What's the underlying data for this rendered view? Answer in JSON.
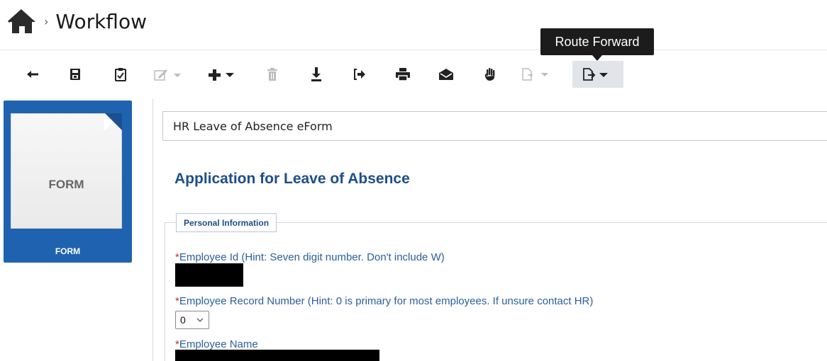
{
  "breadcrumb": {
    "home_icon": "home-icon",
    "separator": "›",
    "title": "Workflow"
  },
  "toolbar": {
    "buttons": [
      {
        "name": "back-button",
        "icon": "arrow-left-icon",
        "enabled": true
      },
      {
        "name": "save-button",
        "icon": "save-icon",
        "enabled": true
      },
      {
        "name": "validate-button",
        "icon": "clipboard-check-icon",
        "enabled": true
      },
      {
        "name": "edit-dropdown-button",
        "icon": "edit-icon",
        "enabled": false
      },
      {
        "name": "add-dropdown-button",
        "icon": "plus-icon",
        "enabled": true
      },
      {
        "name": "delete-button",
        "icon": "trash-icon",
        "enabled": false
      },
      {
        "name": "download-button",
        "icon": "download-icon",
        "enabled": true
      },
      {
        "name": "exit-button",
        "icon": "sign-out-icon",
        "enabled": true
      },
      {
        "name": "print-button",
        "icon": "print-icon",
        "enabled": true
      },
      {
        "name": "email-button",
        "icon": "envelope-open-icon",
        "enabled": true
      },
      {
        "name": "stop-button",
        "icon": "hand-icon",
        "enabled": true
      },
      {
        "name": "route-back-dropdown-button",
        "icon": "route-icon",
        "enabled": false
      },
      {
        "name": "route-forward-dropdown-button",
        "icon": "route-icon",
        "enabled": true,
        "active": true
      }
    ],
    "tooltip": "Route Forward"
  },
  "thumbnail": {
    "page_text": "FORM",
    "caption": "FORM",
    "color": "#1f63b0"
  },
  "document": {
    "title": "HR Leave of Absence eForm",
    "heading": "Application for Leave of Absence",
    "section_legend": "Personal Information",
    "fields": {
      "employee_id_label": "Employee Id (Hint: Seven digit number. Don't include W)",
      "employee_record_label": "Employee Record Number (Hint: 0 is primary for most employees. If unsure contact HR)",
      "employee_record_value": "0",
      "employee_name_label": "Employee Name",
      "required_marker": "*"
    }
  },
  "colors": {
    "heading": "#1d4e89",
    "label": "#2a5f9e",
    "required": "#b3312b",
    "active_toolbar_bg": "#e1e4e8"
  }
}
